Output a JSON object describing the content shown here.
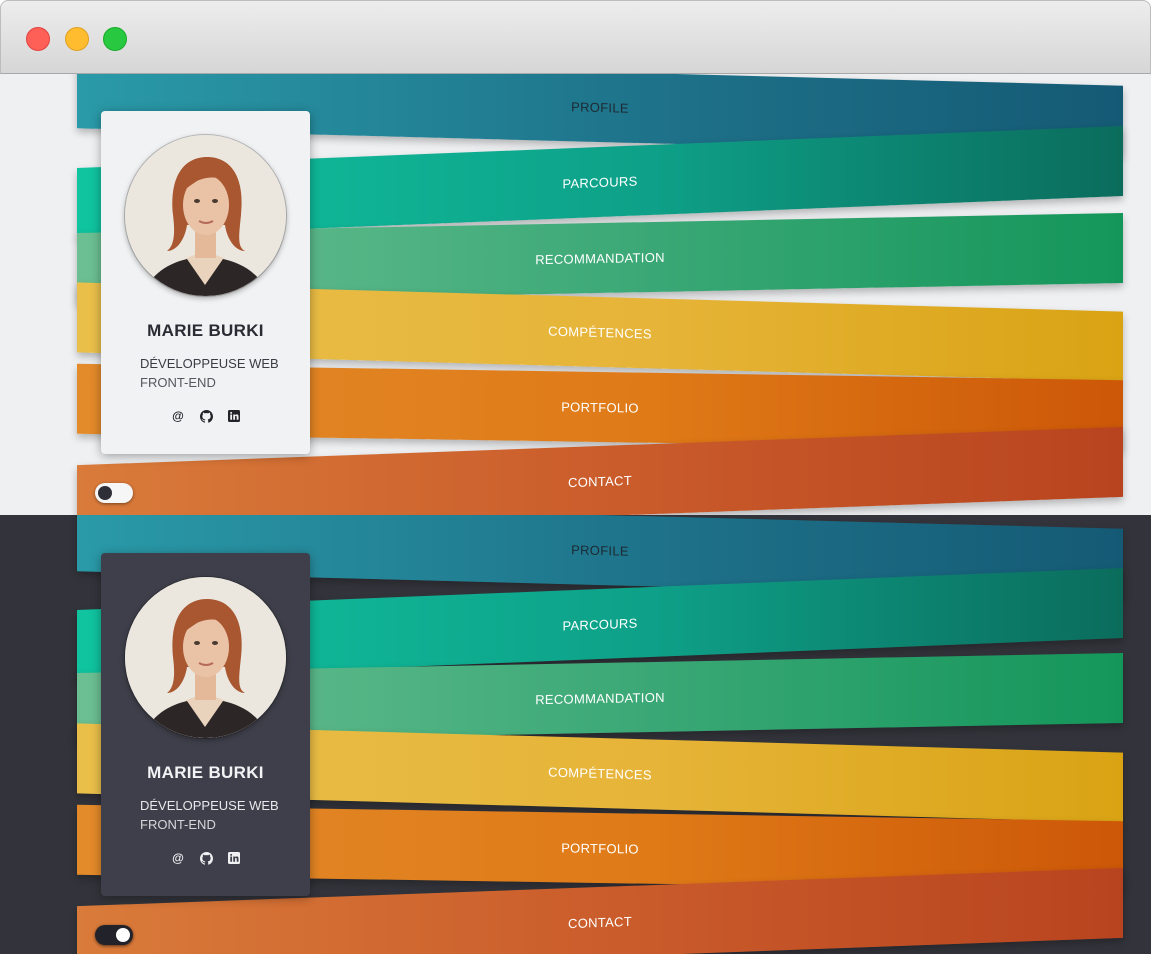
{
  "window": {
    "controls": [
      "close",
      "minimize",
      "maximize"
    ]
  },
  "light": {
    "theme": "light",
    "nav": [
      "PROFILE",
      "PARCOURS",
      "RECOMMANDATION",
      "COMPÉTENCES",
      "PORTFOLIO",
      "CONTACT"
    ],
    "profile": {
      "name": "MARIE BURKI",
      "role_line1": "DÉVELOPPEUSE WEB",
      "role_line2": "FRONT-END"
    },
    "socials": [
      {
        "icon": "email-icon",
        "glyph": "@"
      },
      {
        "icon": "github-icon",
        "glyph": ""
      },
      {
        "icon": "linkedin-icon",
        "glyph": "in"
      }
    ],
    "dark_mode_toggle": {
      "on": false
    }
  },
  "dark": {
    "theme": "dark",
    "nav": [
      "PROFILE",
      "PARCOURS",
      "RECOMMANDATION",
      "COMPÉTENCES",
      "PORTFOLIO",
      "CONTACT"
    ],
    "profile": {
      "name": "MARIE BURKI",
      "role_line1": "DÉVELOPPEUSE WEB",
      "role_line2": "FRONT-END"
    },
    "socials": [
      {
        "icon": "email-icon",
        "glyph": "@"
      },
      {
        "icon": "github-icon",
        "glyph": ""
      },
      {
        "icon": "linkedin-icon",
        "glyph": "in"
      }
    ],
    "dark_mode_toggle": {
      "on": true
    }
  },
  "colors": {
    "profile": "#1d6f87",
    "parcours": "#0ea088",
    "recommandation": "#3aa876",
    "competences": "#e6b438",
    "portfolio": "#df7a17",
    "contact": "#c95a2a",
    "light_bg": "#eff0f2",
    "dark_bg": "#33343b"
  }
}
